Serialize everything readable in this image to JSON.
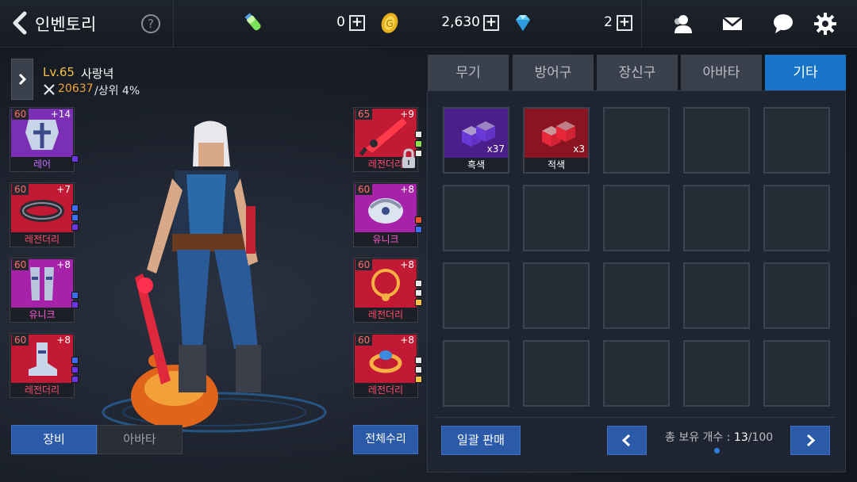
{
  "header": {
    "title": "인벤토리",
    "help_label": "?",
    "currencies": [
      {
        "icon": "energy-potion-icon",
        "value": "0",
        "plus": "+"
      },
      {
        "icon": "gold-coin-icon",
        "value": "2,630",
        "plus": "+"
      },
      {
        "icon": "diamond-icon",
        "value": "2",
        "plus": "+"
      }
    ],
    "icons": [
      "friends-icon",
      "mail-icon",
      "chat-icon",
      "settings-gear-icon"
    ]
  },
  "character": {
    "level": "Lv.65",
    "name": "사랑녁",
    "power": "20637",
    "rank": "/상위 4%",
    "left_slots": [
      {
        "level": "60",
        "plus": "+14",
        "rarity": "레어",
        "rarity_color": "#c06bff",
        "kind": "armor",
        "bg": "#7b2fb5",
        "gems": [
          "#6b35e8"
        ]
      },
      {
        "level": "60",
        "plus": "+7",
        "rarity": "레전더리",
        "rarity_color": "#ff4d6d",
        "kind": "belt",
        "bg": "#c21a34",
        "gems": [
          "#3b6ef0",
          "#3b6ef0",
          "#6b35e8"
        ]
      },
      {
        "level": "60",
        "plus": "+8",
        "rarity": "유니크",
        "rarity_color": "#ff5cd6",
        "kind": "greaves",
        "bg": "#a622a8",
        "gems": [
          "#3b6ef0",
          "#6b35e8"
        ]
      },
      {
        "level": "60",
        "plus": "+8",
        "rarity": "레전더리",
        "rarity_color": "#ff4d6d",
        "kind": "boots",
        "bg": "#c21a34",
        "gems": [
          "#3b6ef0",
          "#6b35e8",
          "#6b35e8"
        ]
      }
    ],
    "right_slots": [
      {
        "level": "65",
        "plus": "+9",
        "rarity": "레전더리",
        "rarity_color": "#ff4d6d",
        "kind": "weapon",
        "bg": "#c21a34",
        "gems": [
          "#e8e8e8",
          "#8ee04a",
          "#e8e8e8"
        ],
        "locked": true
      },
      {
        "level": "60",
        "plus": "+8",
        "rarity": "유니크",
        "rarity_color": "#ff5cd6",
        "kind": "shoulder",
        "bg": "#a622a8",
        "gems": [
          "#e8552a",
          "#3b6ef0"
        ]
      },
      {
        "level": "60",
        "plus": "+8",
        "rarity": "레전더리",
        "rarity_color": "#ff4d6d",
        "kind": "necklace",
        "bg": "#c21a34",
        "gems": [
          "#e8e8e8",
          "#e8e8e8",
          "#f5c242"
        ]
      },
      {
        "level": "60",
        "plus": "+8",
        "rarity": "레전더리",
        "rarity_color": "#ff4d6d",
        "kind": "ring",
        "bg": "#c21a34",
        "gems": [
          "#e8e8e8",
          "#e8e8e8",
          "#f5c242"
        ]
      }
    ],
    "buttons": {
      "equip": "장비",
      "avatar": "아바타",
      "repair_all": "전체수리"
    }
  },
  "inventory": {
    "tabs": [
      {
        "label": "무기",
        "active": false
      },
      {
        "label": "방어구",
        "active": false
      },
      {
        "label": "장신구",
        "active": false
      },
      {
        "label": "아바타",
        "active": false
      },
      {
        "label": "기타",
        "active": true
      }
    ],
    "items": [
      {
        "name": "흑색",
        "qty": "x37",
        "color": "#6a3ad8",
        "bg": "#4a1f8a"
      },
      {
        "name": "적색",
        "qty": "x3",
        "color": "#e8283a",
        "bg": "#8a1422"
      }
    ],
    "total_cells": 20,
    "bulk_sell": "일괄 판매",
    "count_label": "총 보유 개수 : ",
    "count_current": "13",
    "count_max": "/100"
  }
}
